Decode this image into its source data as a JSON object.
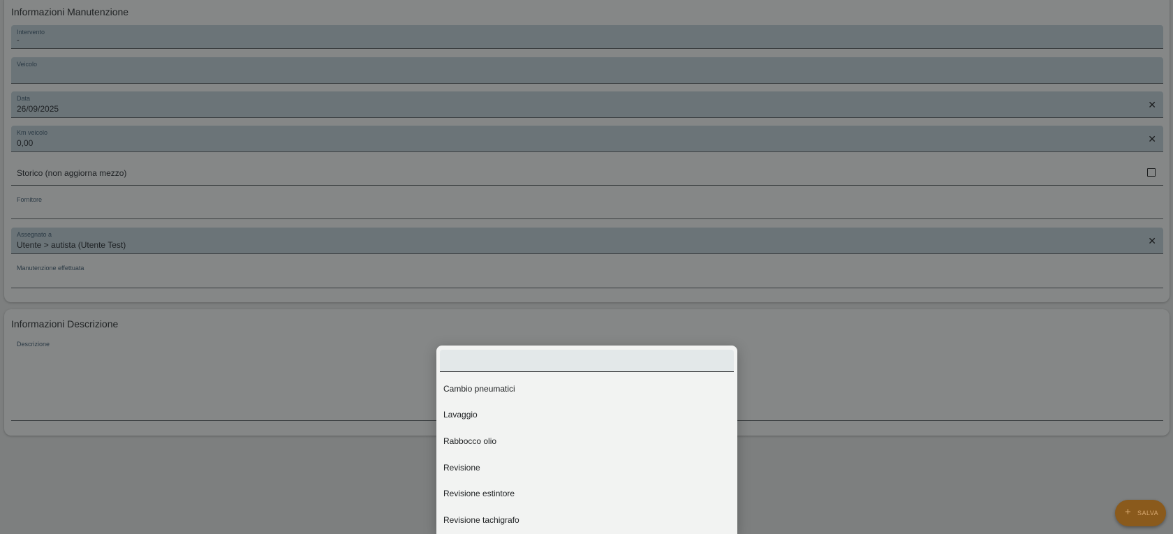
{
  "maintenance": {
    "title": "Informazioni Manutenzione",
    "intervento": {
      "label": "Intervento",
      "value": "-"
    },
    "veicolo": {
      "label": "Veicolo",
      "value": ""
    },
    "data": {
      "label": "Data",
      "value": "26/09/2025"
    },
    "km": {
      "label": "Km veicolo",
      "value": "0,00"
    },
    "storico": {
      "label": "Storico (non aggiorna mezzo)",
      "checked": false
    },
    "fornitore": {
      "label": "Fornitore",
      "value": ""
    },
    "assegnato": {
      "label": "Assegnato a",
      "value": "Utente > autista (Utente Test)"
    },
    "effettuata": {
      "label": "Manutenzione effettuata",
      "value": ""
    }
  },
  "description": {
    "title": "Informazioni Descrizione",
    "descrizione": {
      "label": "Descrizione",
      "value": ""
    }
  },
  "dropdown": {
    "search_value": "",
    "options": [
      "Cambio pneumatici",
      "Lavaggio",
      "Rabbocco olio",
      "Revisione",
      "Revisione estintore",
      "Revisione tachigrafo"
    ]
  },
  "fab": {
    "plus": "+",
    "label": "SALVA"
  },
  "icons": {
    "clear": "✕"
  },
  "colors": {
    "accent": "#8a5a1c",
    "overlay": "#7d7f7f"
  }
}
